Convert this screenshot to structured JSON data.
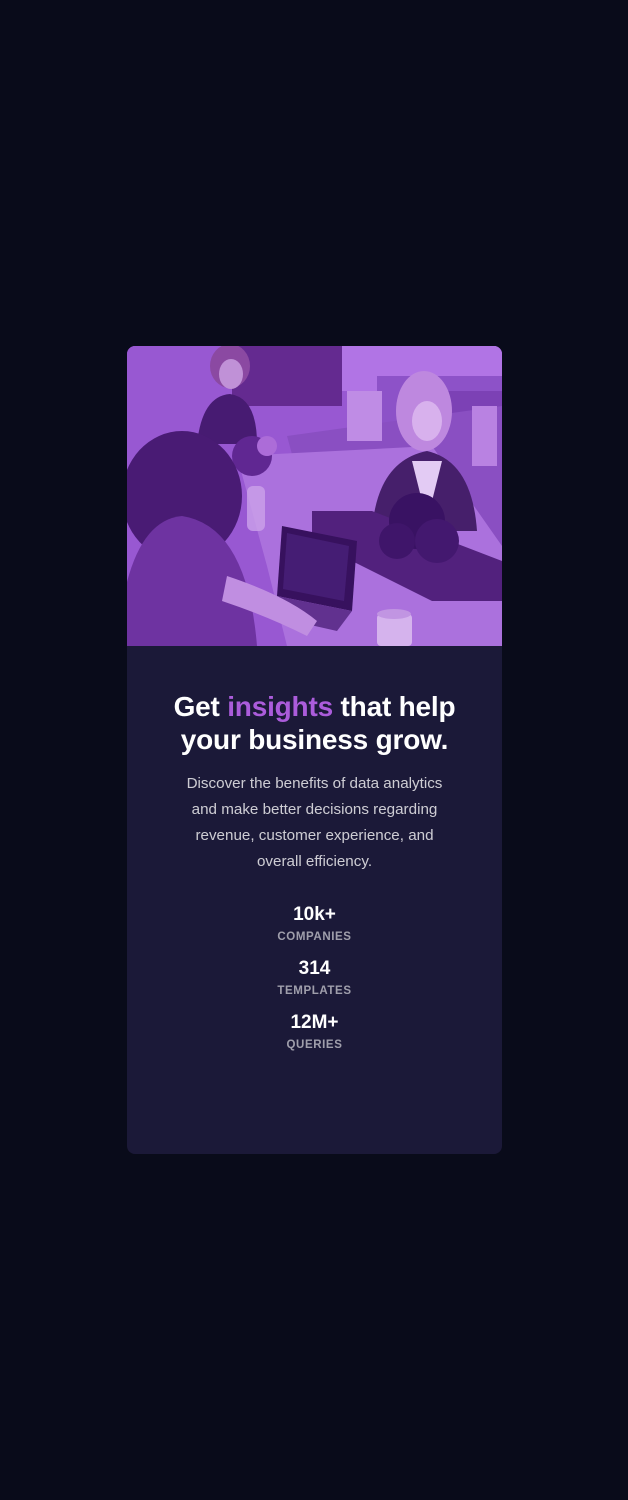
{
  "card": {
    "headline": {
      "before": "Get ",
      "accent": "insights",
      "after": " that help your business grow."
    },
    "description": "Discover the benefits of data analytics and make better decisions regarding revenue, customer experience, and overall efficiency.",
    "stats": [
      {
        "value": "10k+",
        "label": "COMPANIES"
      },
      {
        "value": "314",
        "label": "TEMPLATES"
      },
      {
        "value": "12M+",
        "label": "QUERIES"
      }
    ]
  },
  "colors": {
    "page_background": "#090b1a",
    "card_background": "#1b1938",
    "accent": "#ab5cdb",
    "image_overlay": "#8a4fc2"
  }
}
